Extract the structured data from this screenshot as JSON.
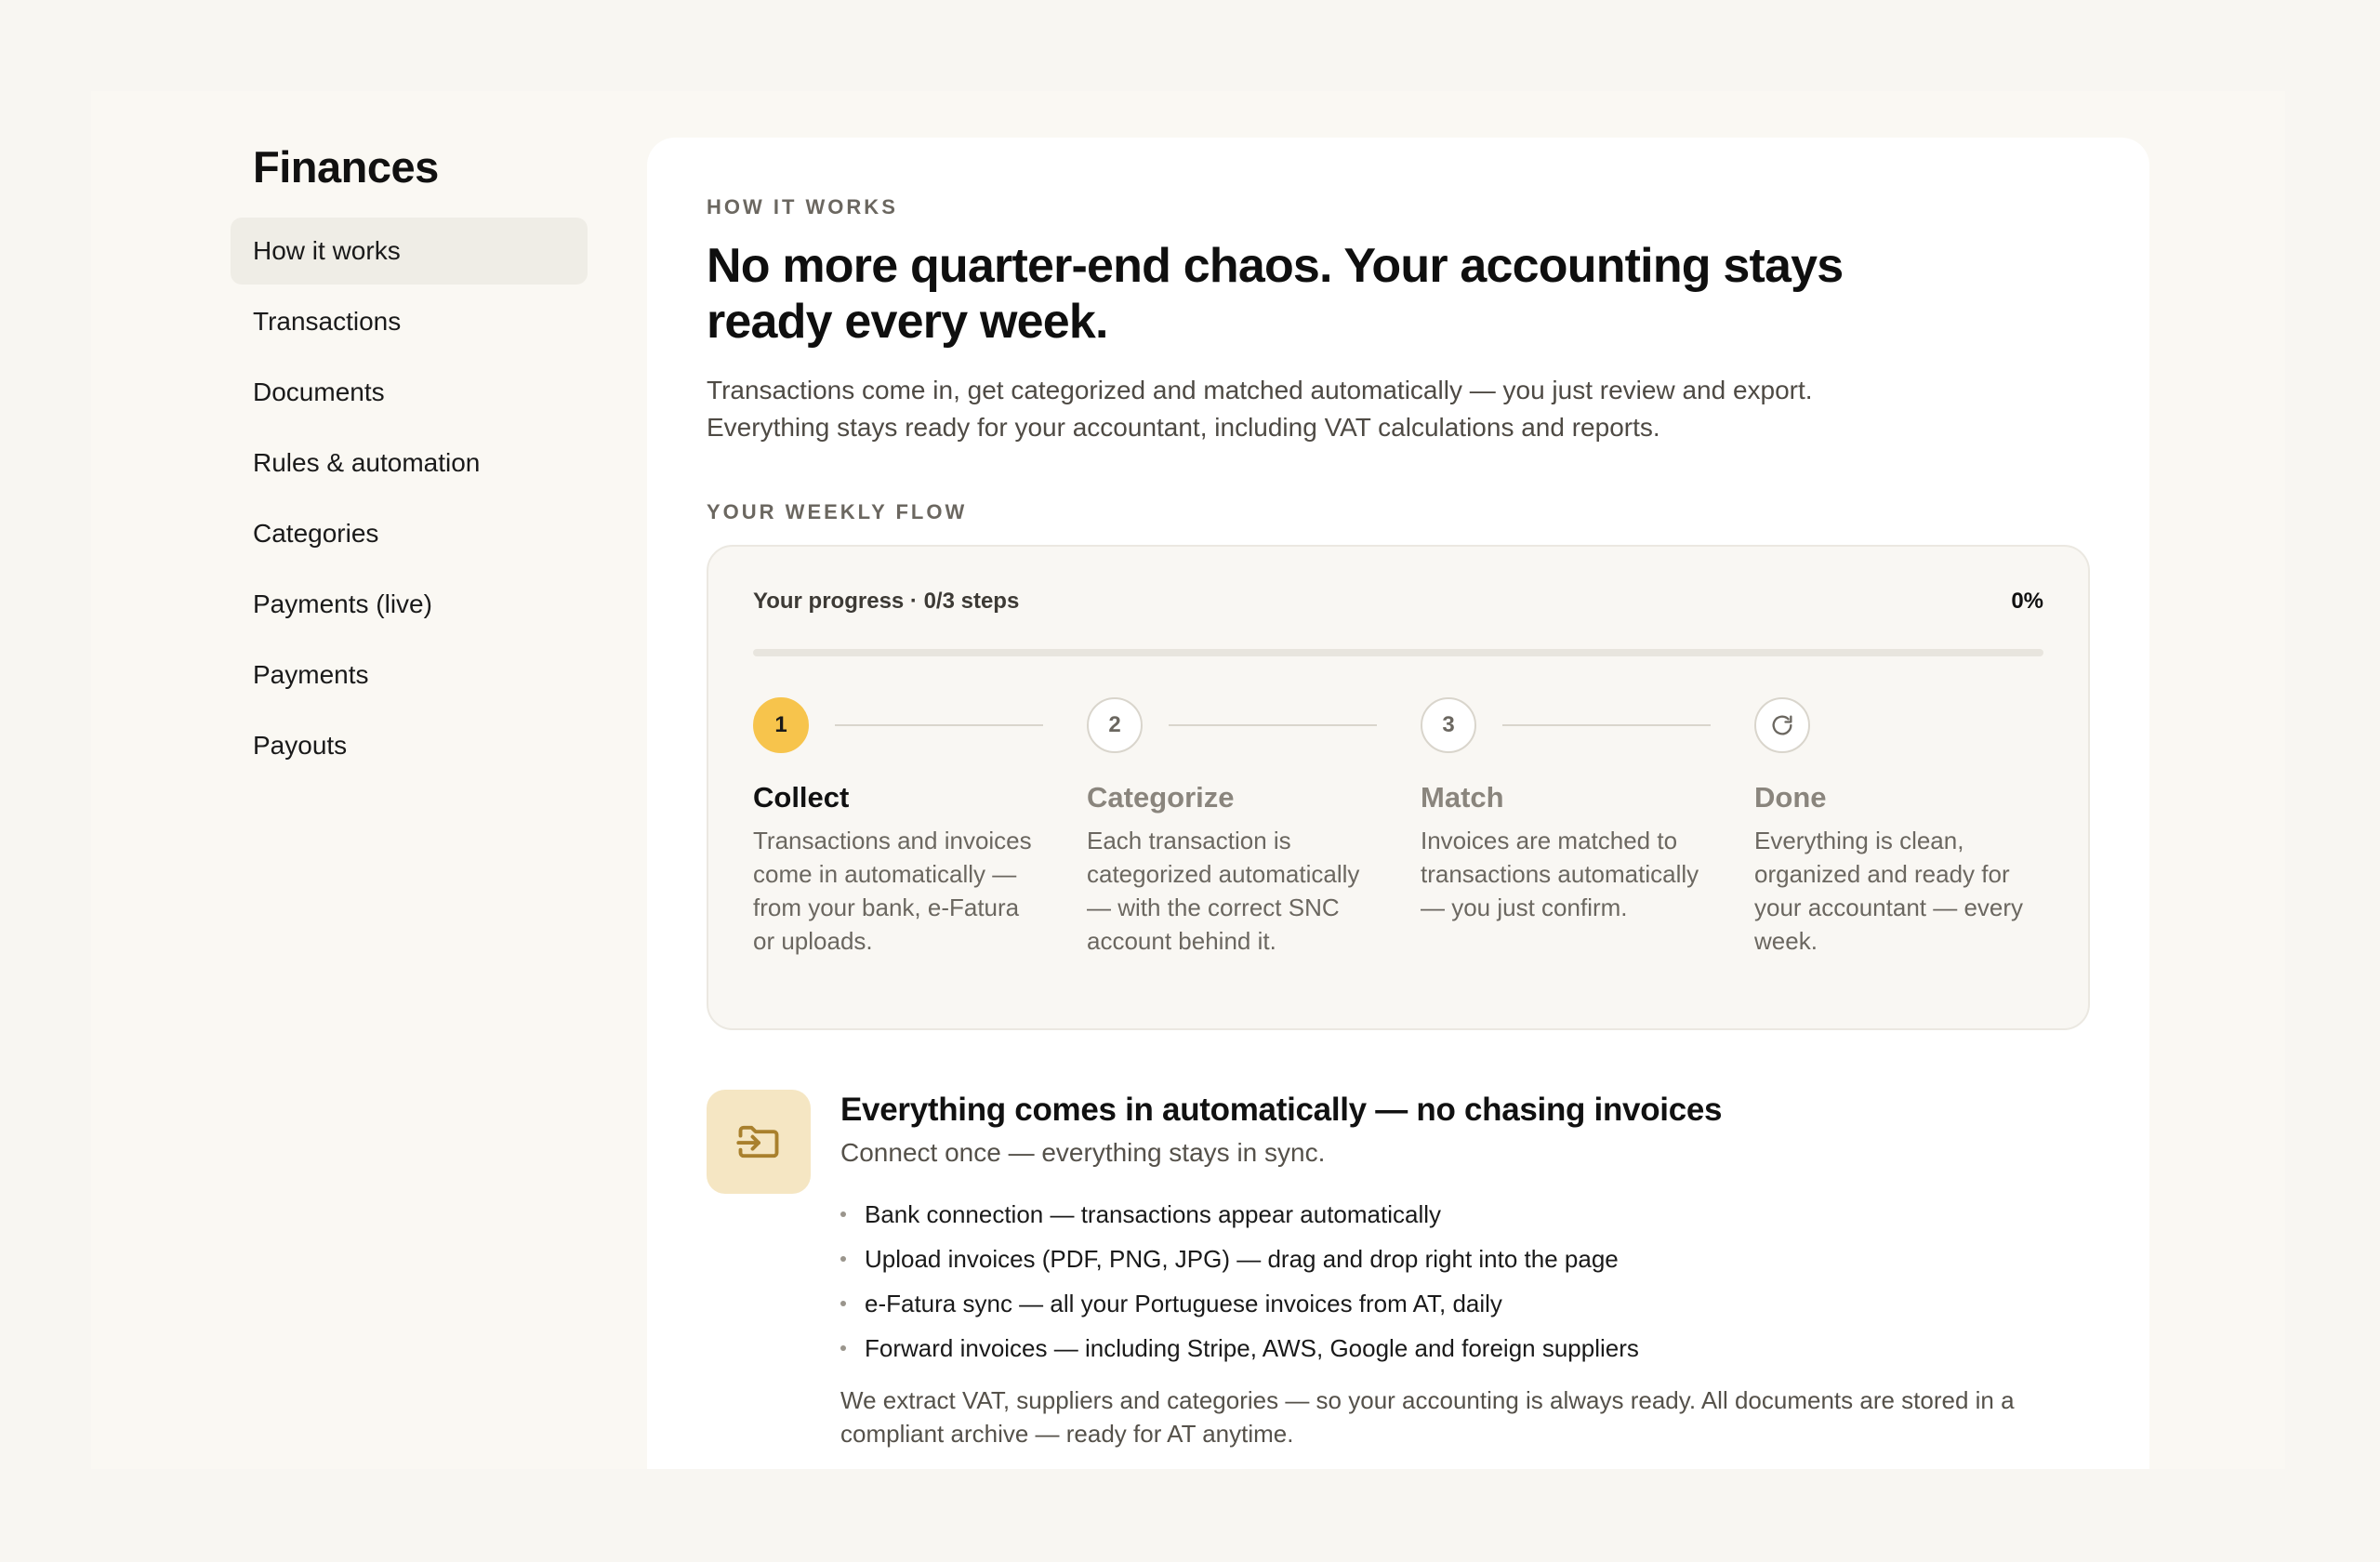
{
  "sidebar": {
    "title": "Finances",
    "items": [
      {
        "label": "How it works",
        "active": true
      },
      {
        "label": "Transactions"
      },
      {
        "label": "Documents"
      },
      {
        "label": "Rules & automation"
      },
      {
        "label": "Categories"
      },
      {
        "label": "Payments (live)"
      },
      {
        "label": "Payments"
      },
      {
        "label": "Payouts"
      }
    ]
  },
  "main": {
    "eyebrow": "HOW IT WORKS",
    "headline": "No more quarter-end chaos. Your accounting stays ready every week.",
    "lead": "Transactions come in, get categorized and matched automatically — you just review and export. Everything stays ready for your accountant, including VAT calculations and reports.",
    "flow_label": "YOUR WEEKLY FLOW",
    "progress": {
      "label": "Your progress · 0/3 steps",
      "percent_text": "0%",
      "fraction": 0
    },
    "steps": [
      {
        "number": "1",
        "title": "Collect",
        "desc": "Transactions and invoices come in automatically — from your bank, e-Fatura or uploads.",
        "active": true
      },
      {
        "number": "2",
        "title": "Categorize",
        "desc": "Each transaction is categorized automatically — with the correct SNC account behind it."
      },
      {
        "number": "3",
        "title": "Match",
        "desc": "Invoices are matched to transactions automatically — you just confirm."
      },
      {
        "icon": "refresh-icon",
        "title": "Done",
        "desc": "Everything is clean, organized and ready for your accountant — every week."
      }
    ],
    "feature": {
      "icon": "folder-import-icon",
      "title": "Everything comes in automatically — no chasing invoices",
      "subtitle": "Connect once — everything stays in sync.",
      "bullets": [
        "Bank connection — transactions appear automatically",
        "Upload invoices (PDF, PNG, JPG) — drag and drop right into the page",
        "e-Fatura sync — all your Portuguese invoices from AT, daily",
        "Forward invoices — including Stripe, AWS, Google and foreign suppliers"
      ],
      "note": "We extract VAT, suppliers and categories — so your accounting is always ready. All documents are stored in a compliant archive — ready for AT anytime."
    }
  },
  "colors": {
    "accent": "#f7c44c",
    "icon_tile": "#f5e6c3",
    "icon_stroke": "#a9802d"
  }
}
